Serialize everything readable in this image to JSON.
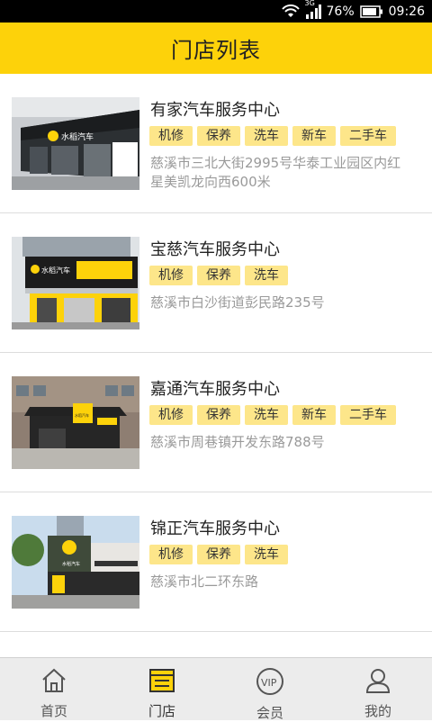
{
  "status_bar": {
    "network": "3G",
    "battery": "76%",
    "time": "09:26"
  },
  "header": {
    "title": "门店列表"
  },
  "stores": [
    {
      "name": "有家汽车服务中心",
      "tags": [
        "机修",
        "保养",
        "洗车",
        "新车",
        "二手车"
      ],
      "address": "慈溪市三北大街2995号华泰工业园区内红星美凯龙向西600米",
      "sign": "水稻汽车"
    },
    {
      "name": "宝慈汽车服务中心",
      "tags": [
        "机修",
        "保养",
        "洗车"
      ],
      "address": "慈溪市白沙街道彭民路235号",
      "sign": "水稻汽车"
    },
    {
      "name": "嘉通汽车服务中心",
      "tags": [
        "机修",
        "保养",
        "洗车",
        "新车",
        "二手车"
      ],
      "address": "慈溪市周巷镇开发东路788号",
      "sign": "水稻汽车"
    },
    {
      "name": "锦正汽车服务中心",
      "tags": [
        "机修",
        "保养",
        "洗车"
      ],
      "address": "慈溪市北二环东路",
      "sign": "水稻汽车"
    }
  ],
  "tabbar": {
    "items": [
      {
        "label": "首页",
        "icon": "home-icon"
      },
      {
        "label": "门店",
        "icon": "store-list-icon"
      },
      {
        "label": "会员",
        "icon": "vip-icon"
      },
      {
        "label": "我的",
        "icon": "profile-icon"
      }
    ],
    "active": "门店"
  },
  "colors": {
    "accent": "#fdd20a",
    "tag_bg": "#fde68a",
    "address": "#9a9a9a"
  }
}
